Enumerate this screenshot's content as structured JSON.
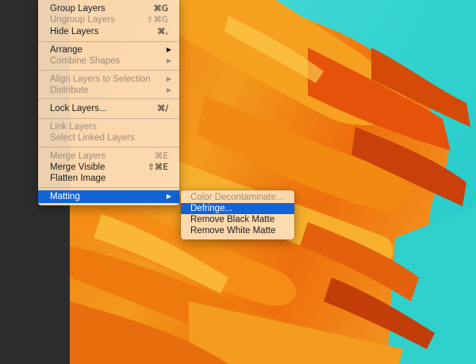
{
  "main_menu": {
    "items": [
      {
        "label": "Group Layers",
        "shortcut": "⌘G",
        "disabled": false
      },
      {
        "label": "Ungroup Layers",
        "shortcut": "⇧⌘G",
        "disabled": true
      },
      {
        "label": "Hide Layers",
        "shortcut": "⌘,",
        "disabled": false
      },
      {
        "label": "Arrange",
        "submenu": true,
        "disabled": false
      },
      {
        "label": "Combine Shapes",
        "submenu": true,
        "disabled": true
      },
      {
        "label": "Align Layers to Selection",
        "submenu": true,
        "disabled": true
      },
      {
        "label": "Distribute",
        "submenu": true,
        "disabled": true
      },
      {
        "label": "Lock Layers...",
        "shortcut": "⌘/",
        "disabled": false
      },
      {
        "label": "Link Layers",
        "disabled": true
      },
      {
        "label": "Select Linked Layers",
        "disabled": true
      },
      {
        "label": "Merge Layers",
        "shortcut": "⌘E",
        "disabled": true
      },
      {
        "label": "Merge Visible",
        "shortcut": "⇧⌘E",
        "disabled": false
      },
      {
        "label": "Flatten Image",
        "disabled": false
      },
      {
        "label": "Matting",
        "submenu": true,
        "disabled": false,
        "active": true
      }
    ],
    "arrow_glyph": "▶"
  },
  "submenu": {
    "items": [
      {
        "label": "Color Decontaminate...",
        "disabled": true
      },
      {
        "label": "Defringe...",
        "disabled": false,
        "active": true
      },
      {
        "label": "Remove Black Matte",
        "disabled": false
      },
      {
        "label": "Remove White Matte",
        "disabled": false
      }
    ]
  },
  "colors": {
    "highlight": "#1264d6",
    "canvas_orange": "#f07a10",
    "canvas_cyan": "#2fd3cf",
    "menu_bg": "#fcdeb9"
  }
}
